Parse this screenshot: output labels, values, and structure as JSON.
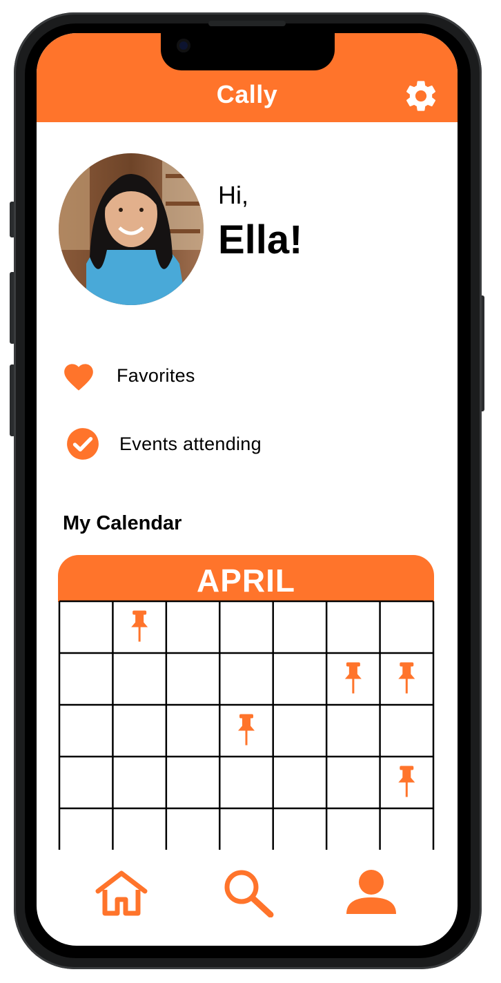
{
  "app": {
    "title": "Cally",
    "accent_color": "#ff742b"
  },
  "header": {
    "settings_icon": "gear-icon"
  },
  "profile": {
    "greeting": "Hi,",
    "name": "Ella!",
    "avatar_icon": "user-photo"
  },
  "menu": [
    {
      "label": "Favorites",
      "icon": "heart-icon"
    },
    {
      "label": "Events attending",
      "icon": "check-circle-icon"
    }
  ],
  "calendar": {
    "section_title": "My Calendar",
    "month": "APRIL",
    "rows": 5,
    "cols": 7,
    "pinned_cells": [
      {
        "row": 1,
        "col": 2
      },
      {
        "row": 2,
        "col": 6
      },
      {
        "row": 2,
        "col": 7
      },
      {
        "row": 3,
        "col": 4
      },
      {
        "row": 4,
        "col": 7
      }
    ],
    "pin_icon": "pushpin-icon"
  },
  "bottom_nav": [
    {
      "name": "home",
      "icon": "home-icon"
    },
    {
      "name": "search",
      "icon": "search-icon"
    },
    {
      "name": "profile",
      "icon": "person-icon"
    }
  ]
}
